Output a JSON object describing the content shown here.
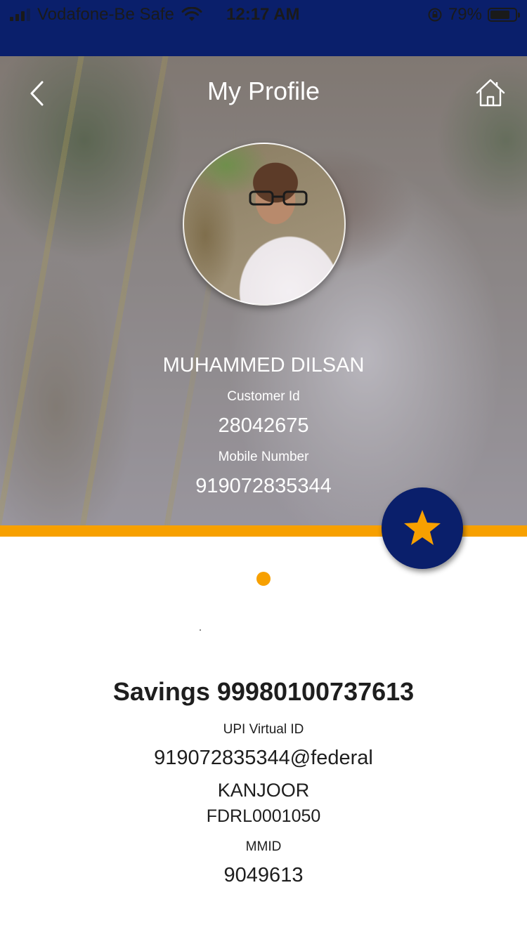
{
  "status_bar": {
    "carrier": "Vodafone-Be Safe",
    "time": "12:17 AM",
    "battery_percent_label": "79%",
    "battery_level": 0.79
  },
  "header": {
    "title": "My Profile",
    "back_icon": "chevron-left-icon",
    "home_icon": "home-icon"
  },
  "profile": {
    "name": "MUHAMMED DILSAN",
    "customer_id_label": "Customer Id",
    "customer_id": "28042675",
    "mobile_label": "Mobile Number",
    "mobile_number": "919072835344"
  },
  "favorite": {
    "icon": "star-icon"
  },
  "account": {
    "title": "Savings 99980100737613",
    "upi_label": "UPI Virtual ID",
    "upi_id": "919072835344@federal",
    "branch": "KANJOOR",
    "ifsc": "FDRL0001050",
    "mmid_label": "MMID",
    "mmid": "9049613"
  },
  "colors": {
    "navy": "#0a1f6b",
    "accent_orange": "#f7a000"
  }
}
